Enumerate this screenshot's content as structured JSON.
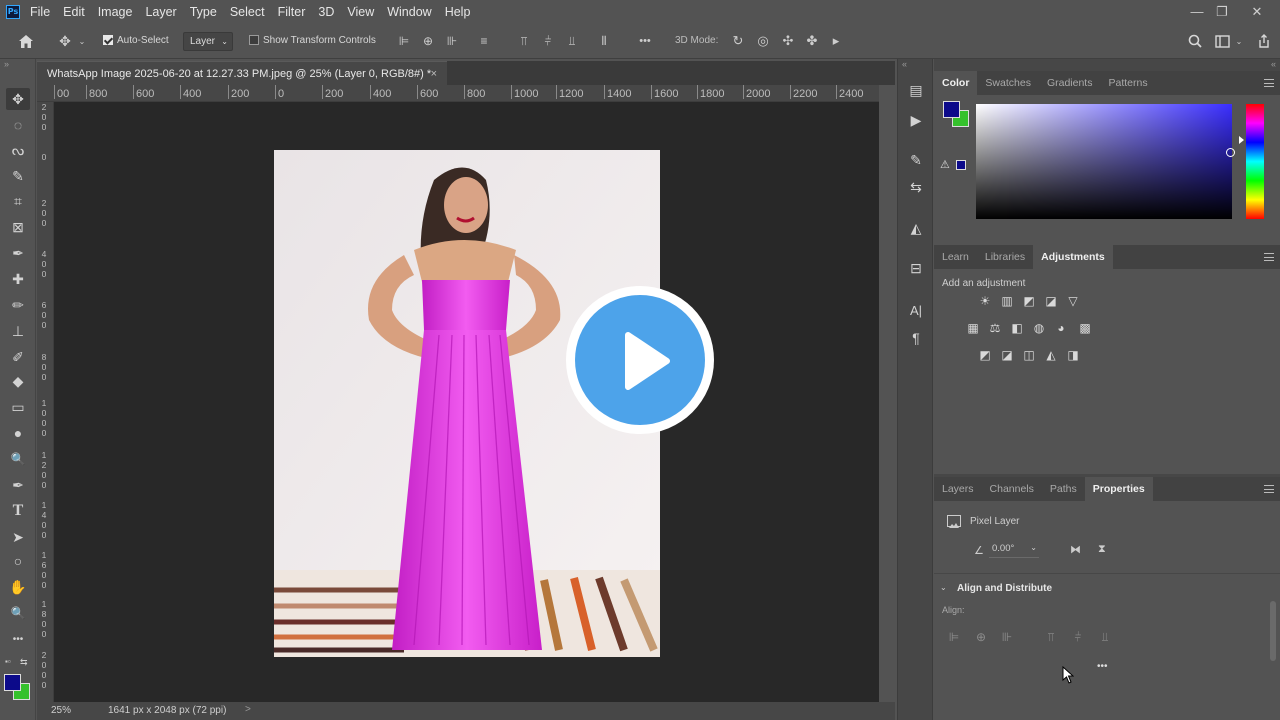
{
  "menu": {
    "items": [
      "File",
      "Edit",
      "Image",
      "Layer",
      "Type",
      "Select",
      "Filter",
      "3D",
      "View",
      "Window",
      "Help"
    ],
    "app_icon": "ps-logo",
    "app_icon_text": "Ps"
  },
  "window_controls": {
    "minimize": "—",
    "restore": "❐",
    "close": "✕"
  },
  "options_bar": {
    "home_icon": "home-icon",
    "move_icon": "move-tool-icon",
    "auto_select_label": "Auto-Select",
    "auto_select_checked": true,
    "layer_dropdown": "Layer",
    "show_transform_label": "Show Transform Controls",
    "show_transform_checked": false,
    "more": "•••",
    "mode_3d": "3D Mode:"
  },
  "document": {
    "tab_title": "WhatsApp Image 2025-06-20 at 12.27.33 PM.jpeg @ 25% (Layer 0, RGB/8#) *",
    "close": "×"
  },
  "ruler": {
    "h_ticks": [
      "00",
      "800",
      "600",
      "400",
      "200",
      "0",
      "200",
      "400",
      "600",
      "800",
      "1000",
      "1200",
      "1400",
      "1600",
      "1800",
      "2000",
      "2200",
      "2400"
    ],
    "v_ticks": [
      "2\n0\n0",
      "0",
      "2\n0\n0",
      "4\n0\n0",
      "6\n0\n0",
      "8\n0\n0",
      "1\n0\n0\n0",
      "1\n2\n0\n0",
      "1\n4\n0\n0",
      "1\n6\n0\n0",
      "1\n8\n0\n0",
      "2\n0\n0\n0"
    ]
  },
  "status_bar": {
    "zoom": "25%",
    "doc_size": "1641 px x 2048 px (72 ppi)",
    "arrow": ">"
  },
  "tools": [
    "move-tool-icon",
    "marquee-tool-icon",
    "lasso-tool-icon",
    "quick-select-tool-icon",
    "crop-tool-icon",
    "frame-tool-icon",
    "eyedropper-tool-icon",
    "healing-brush-icon",
    "brush-tool-icon",
    "clone-stamp-icon",
    "history-brush-icon",
    "eraser-tool-icon",
    "gradient-tool-icon",
    "blur-tool-icon",
    "dodge-tool-icon",
    "pen-tool-icon",
    "type-tool-icon",
    "path-select-icon",
    "ellipse-tool-icon",
    "hand-tool-icon",
    "zoom-tool-icon",
    "more-tools-icon"
  ],
  "tool_glyphs": [
    "✥",
    "◌",
    "ᔓ",
    "✎",
    "⌗",
    "⊠",
    "✒",
    "✚",
    "✏",
    "⊥",
    "✐",
    "◆",
    "▭",
    "●",
    "🔍",
    "✒",
    "T",
    "➤",
    "○",
    "✋",
    "🔍",
    "•••"
  ],
  "colors": {
    "foreground": "#0c0a8a",
    "background": "#35c12c",
    "accent": "#31a8ff",
    "play_button": "#4da3ea"
  },
  "color_panel": {
    "tabs": [
      "Color",
      "Swatches",
      "Gradients",
      "Patterns"
    ],
    "active_tab": "Color"
  },
  "adjust_panel": {
    "tabs": [
      "Learn",
      "Libraries",
      "Adjustments"
    ],
    "active_tab": "Adjustments",
    "heading": "Add an adjustment",
    "icons_row1": [
      "☀",
      "▥",
      "◩",
      "◪",
      "▽"
    ],
    "icons_row2": [
      "▦",
      "⚖",
      "◧",
      "◍",
      "◕",
      "▩"
    ],
    "icons_row3": [
      "◩",
      "◪",
      "◫",
      "◭",
      "◨"
    ]
  },
  "properties_panel": {
    "tabs": [
      "Layers",
      "Channels",
      "Paths",
      "Properties"
    ],
    "active_tab": "Properties",
    "layer_type": "Pixel Layer",
    "angle": "0.00°",
    "section": "Align and Distribute",
    "align_label": "Align:",
    "more": "•••"
  },
  "side_icons": [
    "history-icon",
    "actions-icon",
    "brush-settings-icon",
    "adjust-icon",
    "shape-icon",
    "properties-icon",
    "character-icon",
    "paragraph-icon"
  ],
  "side_glyphs": [
    "▤",
    "▶",
    "✎",
    "⇆",
    "◭",
    "⊟",
    "A|",
    "¶"
  ],
  "video_overlay": {
    "play_icon": "play-button-icon"
  }
}
